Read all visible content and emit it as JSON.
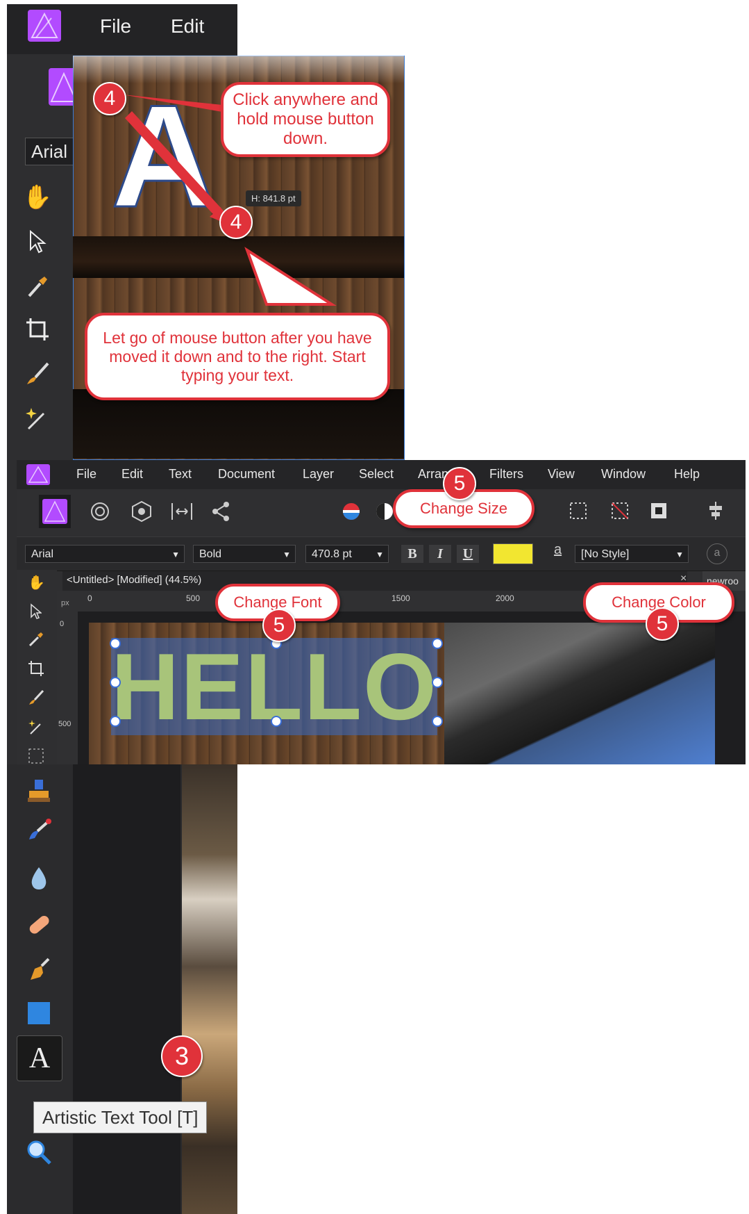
{
  "top_menu": {
    "file": "File",
    "edit": "Edit"
  },
  "font_box": "Arial",
  "photo1": {
    "big_letter": "A",
    "size_tooltip": "H: 841.8 pt"
  },
  "callouts": {
    "click_anywhere": "Click anywhere and hold mouse button down.",
    "let_go": "Let go of mouse button after you have moved it down and to the right. Start typing your text.",
    "change_size": "Change Size",
    "change_font": "Change Font",
    "change_color": "Change Color"
  },
  "badges": {
    "step4a": "4",
    "step4b": "4",
    "step5_size": "5",
    "step5_font": "5",
    "step5_color": "5",
    "step3": "3"
  },
  "menubar": [
    "File",
    "Edit",
    "Text",
    "Document",
    "Layer",
    "Select",
    "Arran",
    "Filters",
    "View",
    "Window",
    "Help"
  ],
  "context_toolbar": {
    "font": "Arial",
    "weight": "Bold",
    "size": "470.8 pt",
    "bold": "B",
    "italic": "I",
    "underline": "U",
    "underline_a": "a",
    "style": "[No Style]",
    "color_fill": "#f2e630"
  },
  "document": {
    "tab_title": "<Untitled> [Modified] (44.5%)",
    "ruler_unit": "px",
    "ruler_ticks": [
      "0",
      "500",
      "1500",
      "2000"
    ],
    "ruler_v_ticks": [
      "0",
      "500"
    ],
    "next_tab": "newroo",
    "text": "HELLO"
  },
  "tool_tooltip": "Artistic Text Tool [T]",
  "text_tool_glyph": "A",
  "colors": {
    "accent_red": "#e0323a",
    "hello_green": "#a8c47a",
    "selection_blue": "#3a68b8",
    "app_dark": "#2f2f31"
  }
}
